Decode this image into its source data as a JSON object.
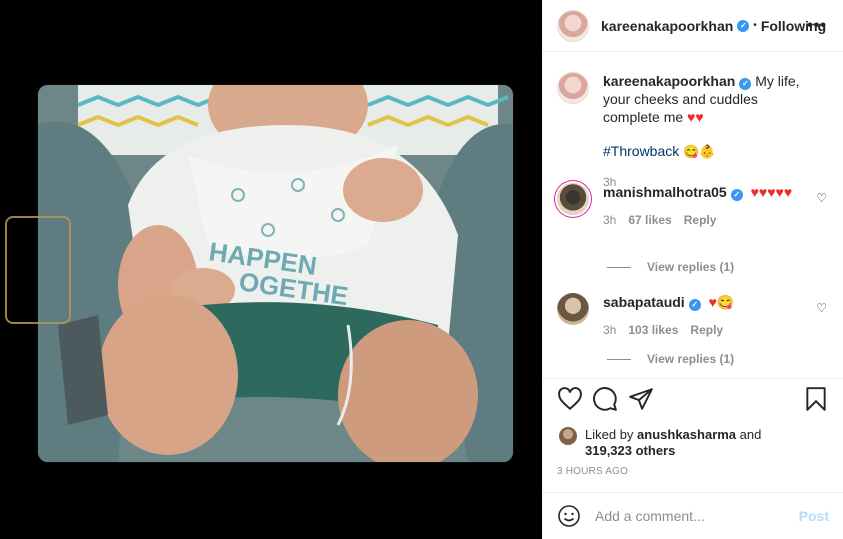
{
  "post": {
    "author": "kareenakapoorkhan",
    "separator": "•",
    "follow_status": "Following",
    "more_label": "•••"
  },
  "caption": {
    "author": "kareenakapoorkhan",
    "text": "My life, your cheeks and cuddles complete me",
    "emoji": "♥♥",
    "hashtag": "#Throwback",
    "hashtag_emoji": "😋👶",
    "time": "3h"
  },
  "comments": [
    {
      "author": "manishmalhotra05",
      "text": "♥♥♥♥♥",
      "time": "3h",
      "likes": "67 likes",
      "reply": "Reply",
      "view_replies": "View replies (1)"
    },
    {
      "author": "sabapataudi",
      "text": "♥😋",
      "time": "3h",
      "likes": "103 likes",
      "reply": "Reply",
      "view_replies": "View replies (1)"
    }
  ],
  "likes": {
    "prefix": "Liked by",
    "user": "anushkasharma",
    "conj": "and",
    "others": "319,323 others"
  },
  "timestamp": "3 HOURS AGO",
  "add_comment": {
    "placeholder": "Add a comment...",
    "post_label": "Post"
  },
  "icons": [
    "more-icon",
    "verified-icon",
    "heart-icon",
    "comment-icon",
    "share-icon",
    "save-icon",
    "emoji-icon"
  ],
  "colors": {
    "link": "#00376b",
    "verified": "#3897f0",
    "heart": "#ed2b2b",
    "post_disabled": "#b3dbff"
  }
}
